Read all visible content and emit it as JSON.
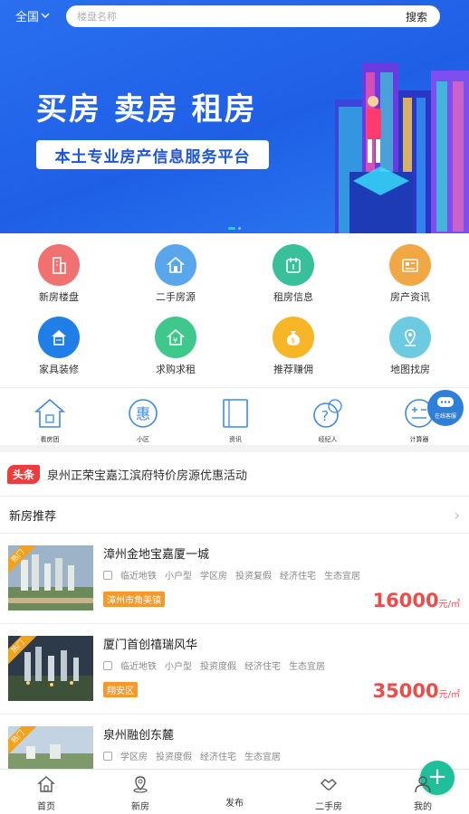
{
  "header": {
    "city": "全国",
    "search_placeholder": "楼盘名称",
    "search_button": "搜索"
  },
  "banner": {
    "headline": "买房 卖房 租房",
    "subtitle": "本土专业房产信息服务平台"
  },
  "grid": [
    {
      "label": "新房楼盘",
      "icon": "building-icon",
      "color": "#f0716f"
    },
    {
      "label": "二手房源",
      "icon": "house-icon",
      "color": "#5aa6ec"
    },
    {
      "label": "租房信息",
      "icon": "rent-icon",
      "color": "#38c09a"
    },
    {
      "label": "房产资讯",
      "icon": "news-icon",
      "color": "#f2a745"
    },
    {
      "label": "家具装修",
      "icon": "decoration-icon",
      "color": "#1f7fe6"
    },
    {
      "label": "求购求租",
      "icon": "wanted-icon",
      "color": "#3ec88c"
    },
    {
      "label": "推荐赚佣",
      "icon": "money-bag-icon",
      "color": "#f6b628"
    },
    {
      "label": "地图找房",
      "icon": "map-pin-icon",
      "color": "#6ccbe0"
    }
  ],
  "row2": [
    {
      "label": "看房团",
      "icon": "house-outline-icon"
    },
    {
      "label": "小区",
      "icon": "benefit-icon",
      "glyph": "惠"
    },
    {
      "label": "资讯",
      "icon": "book-icon"
    },
    {
      "label": "经纪人",
      "icon": "question-bubble-icon"
    },
    {
      "label": "计算器",
      "icon": "calculator-icon"
    }
  ],
  "service": {
    "label": "在线客服",
    "icon": "chat-bubble-icon"
  },
  "news": {
    "tag": "头条",
    "text": "泉州正荣宝嘉江滨府特价房源优惠活动"
  },
  "section": {
    "title": "新房推荐"
  },
  "listings": [
    {
      "ribbon": "热门",
      "title": "漳州金地宝嘉厦一城",
      "tags": [
        "临近地铁",
        "小户型",
        "学区房",
        "投资复假",
        "经济住宅",
        "生态宜居"
      ],
      "location": "漳州市角美镇",
      "price": "16000",
      "unit": "元/㎡"
    },
    {
      "ribbon": "热门",
      "title": "厦门首创禧瑞风华",
      "tags": [
        "临近地铁",
        "小户型",
        "投资度假",
        "经济住宅",
        "生态宜居"
      ],
      "location": "翔安区",
      "price": "35000",
      "unit": "元/㎡"
    },
    {
      "ribbon": "热门",
      "title": "泉州融创东麓",
      "tags": [
        "学区房",
        "投资度假",
        "经济住宅",
        "生态宜居"
      ],
      "location": "",
      "price": "",
      "unit": ""
    }
  ],
  "tabbar": [
    {
      "label": "首页",
      "icon": "home-icon"
    },
    {
      "label": "新房",
      "icon": "location-icon"
    },
    {
      "label": "发布",
      "icon": "plus-icon"
    },
    {
      "label": "二手房",
      "icon": "handshake-icon"
    },
    {
      "label": "我的",
      "icon": "user-icon"
    }
  ]
}
